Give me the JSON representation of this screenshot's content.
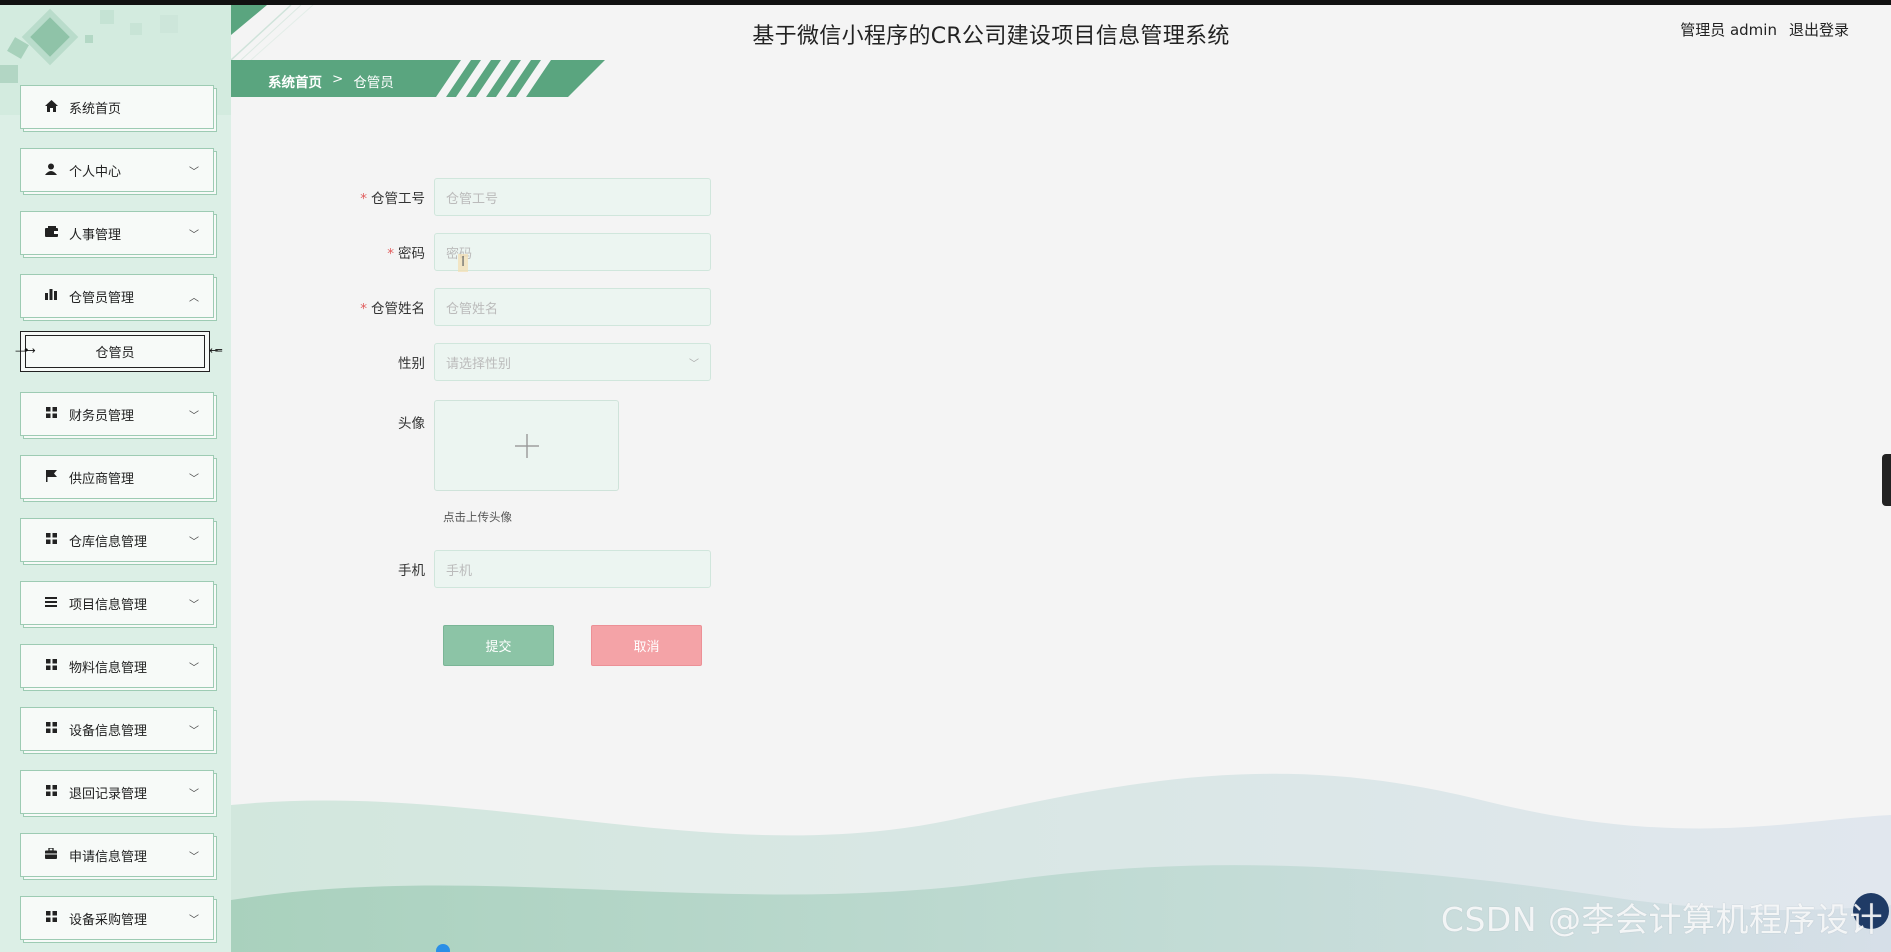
{
  "header": {
    "title": "基于微信小程序的CR公司建设项目信息管理系统",
    "user_label": "管理员 admin",
    "logout": "退出登录"
  },
  "breadcrumb": {
    "home": "系统首页",
    "separator": ">",
    "current": "仓管员"
  },
  "sidebar": {
    "items": [
      {
        "label": "系统首页",
        "icon": "home-icon",
        "arrow": ""
      },
      {
        "label": "个人中心",
        "icon": "user-icon",
        "arrow": "﹀"
      },
      {
        "label": "人事管理",
        "icon": "wallet-icon",
        "arrow": "﹀"
      },
      {
        "label": "仓管员管理",
        "icon": "bar-chart-icon",
        "arrow": "︿"
      },
      {
        "label": "财务员管理",
        "icon": "grid-icon",
        "arrow": "﹀"
      },
      {
        "label": "供应商管理",
        "icon": "flag-icon",
        "arrow": "﹀"
      },
      {
        "label": "仓库信息管理",
        "icon": "grid-icon",
        "arrow": "﹀"
      },
      {
        "label": "项目信息管理",
        "icon": "list-icon",
        "arrow": "﹀"
      },
      {
        "label": "物料信息管理",
        "icon": "grid-icon",
        "arrow": "﹀"
      },
      {
        "label": "设备信息管理",
        "icon": "grid-icon",
        "arrow": "﹀"
      },
      {
        "label": "退回记录管理",
        "icon": "grid-icon",
        "arrow": "﹀"
      },
      {
        "label": "申请信息管理",
        "icon": "briefcase-icon",
        "arrow": "﹀"
      },
      {
        "label": "设备采购管理",
        "icon": "grid-icon",
        "arrow": "﹀"
      }
    ],
    "submenu_active": "仓管员"
  },
  "form": {
    "fields": [
      {
        "label": "仓管工号",
        "required": true,
        "placeholder": "仓管工号"
      },
      {
        "label": "密码",
        "required": true,
        "placeholder": "密码"
      },
      {
        "label": "仓管姓名",
        "required": true,
        "placeholder": "仓管姓名"
      },
      {
        "label": "性别",
        "required": false,
        "placeholder": "请选择性别"
      }
    ],
    "avatar_label": "头像",
    "avatar_hint": "点击上传头像",
    "phone_label": "手机",
    "phone_placeholder": "手机",
    "submit": "提交",
    "cancel": "取消"
  },
  "watermark": "CSDN @李会计算机程序设计",
  "colors": {
    "accent_green": "#8cc4a6",
    "cancel_pink": "#f4a3a7",
    "sidebar_bg": "#dcefe6",
    "required_star": "#e05a5a"
  }
}
